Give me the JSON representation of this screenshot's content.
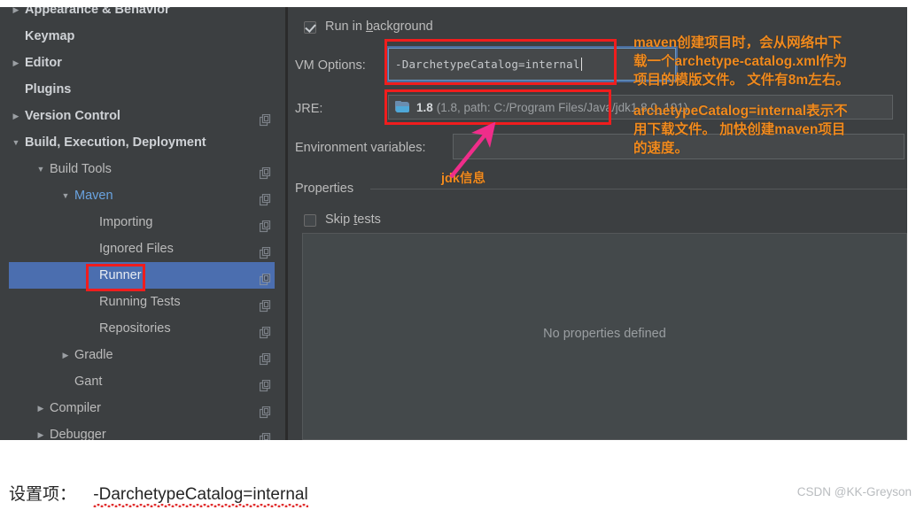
{
  "sidebar": {
    "items": [
      {
        "label": "Appearance & Behavior",
        "indent": 0,
        "twisty": "right",
        "bold": true,
        "copy": false,
        "selected": false,
        "clipped": true
      },
      {
        "label": "Keymap",
        "indent": 0,
        "twisty": "none",
        "bold": true,
        "copy": false,
        "selected": false
      },
      {
        "label": "Editor",
        "indent": 0,
        "twisty": "right",
        "bold": true,
        "copy": false,
        "selected": false
      },
      {
        "label": "Plugins",
        "indent": 0,
        "twisty": "none",
        "bold": true,
        "copy": false,
        "selected": false
      },
      {
        "label": "Version Control",
        "indent": 0,
        "twisty": "right",
        "bold": true,
        "copy": true,
        "selected": false
      },
      {
        "label": "Build, Execution, Deployment",
        "indent": 0,
        "twisty": "down",
        "bold": true,
        "copy": false,
        "selected": false
      },
      {
        "label": "Build Tools",
        "indent": 1,
        "twisty": "down",
        "bold": false,
        "copy": true,
        "selected": false
      },
      {
        "label": "Maven",
        "indent": 2,
        "twisty": "down",
        "bold": false,
        "copy": true,
        "selected": false,
        "link": true
      },
      {
        "label": "Importing",
        "indent": 3,
        "twisty": "none",
        "bold": false,
        "copy": true,
        "selected": false
      },
      {
        "label": "Ignored Files",
        "indent": 3,
        "twisty": "none",
        "bold": false,
        "copy": true,
        "selected": false
      },
      {
        "label": "Runner",
        "indent": 3,
        "twisty": "none",
        "bold": false,
        "copy": true,
        "selected": true
      },
      {
        "label": "Running Tests",
        "indent": 3,
        "twisty": "none",
        "bold": false,
        "copy": true,
        "selected": false
      },
      {
        "label": "Repositories",
        "indent": 3,
        "twisty": "none",
        "bold": false,
        "copy": true,
        "selected": false
      },
      {
        "label": "Gradle",
        "indent": 2,
        "twisty": "right",
        "bold": false,
        "copy": true,
        "selected": false
      },
      {
        "label": "Gant",
        "indent": 2,
        "twisty": "none",
        "bold": false,
        "copy": true,
        "selected": false
      },
      {
        "label": "Compiler",
        "indent": 1,
        "twisty": "right",
        "bold": false,
        "copy": true,
        "selected": false
      },
      {
        "label": "Debugger",
        "indent": 1,
        "twisty": "right",
        "bold": false,
        "copy": true,
        "selected": false,
        "clipped": true
      }
    ]
  },
  "runner": {
    "run_in_background": {
      "label": "Run in background",
      "underline_char": "b",
      "checked": true
    },
    "vm_options": {
      "label": "VM Options:",
      "value": "-DarchetypeCatalog=internal",
      "focused": true
    },
    "jre": {
      "label": "JRE:",
      "version": "1.8",
      "path_text": "(1.8, path: C:/Program Files/Java/jdk1.8.0_191)",
      "icon": "folder-icon"
    },
    "environment_variables": {
      "label": "Environment variables:",
      "value": "",
      "placeholder": ""
    },
    "properties": {
      "section_label": "Properties",
      "skip_tests": {
        "label": "Skip tests",
        "underline_char": "t",
        "checked": false
      },
      "empty_text": "No properties defined"
    }
  },
  "annotations": {
    "note_vm": "maven创建项目时，会从网络中下\n载一个archetype-catalog.xml作为\n项目的模版文件。 文件有8m左右。",
    "note_catalog": "archetypeCatalog=internal表示不\n用下载文件。 加快创建maven项目\n的速度。",
    "note_jdk": "jdk信息",
    "colors": {
      "note_orange": "#f08a1e",
      "box_red": "#f01d1d",
      "arrow_pink": "#ef2d8a",
      "selection_blue": "#4b6eaf"
    }
  },
  "caption": {
    "prefix": "设置项：",
    "value": "-DarchetypeCatalog=internal"
  },
  "watermark": "CSDN @KK-Greyson"
}
